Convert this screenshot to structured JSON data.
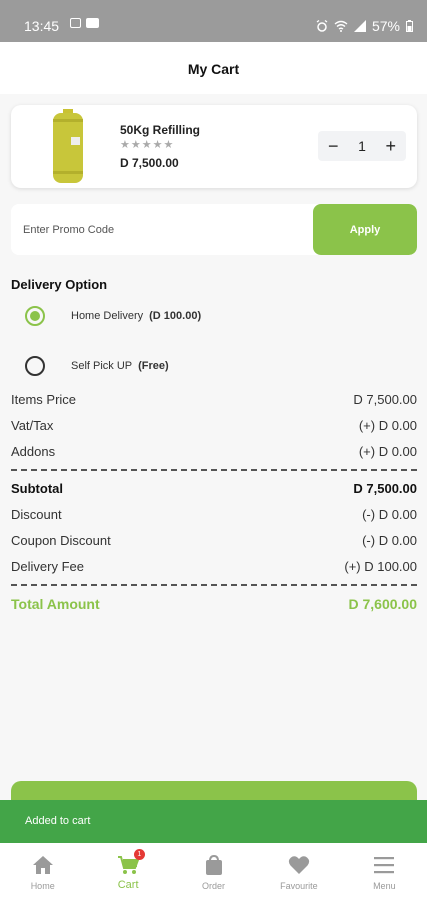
{
  "status_bar": {
    "time": "13:45",
    "battery": "57%"
  },
  "header": {
    "title": "My Cart"
  },
  "cart_item": {
    "name": "50Kg Refilling",
    "stars": "★★★★★",
    "price": "D 7,500.00",
    "quantity": "1",
    "minus_icon": "−",
    "plus_icon": "+"
  },
  "promo": {
    "placeholder": "Enter Promo Code",
    "apply_label": "Apply"
  },
  "delivery": {
    "title": "Delivery Option",
    "options": [
      {
        "label": "Home Delivery",
        "fee": "(D 100.00)",
        "selected": true
      },
      {
        "label": "Self Pick UP",
        "fee": "(Free)",
        "selected": false
      }
    ]
  },
  "summary": {
    "items_price": {
      "label": "Items Price",
      "value": "D 7,500.00"
    },
    "vat": {
      "label": "Vat/Tax",
      "value": "(+) D 0.00"
    },
    "addons": {
      "label": "Addons",
      "value": "(+) D 0.00"
    },
    "subtotal": {
      "label": "Subtotal",
      "value": "D 7,500.00"
    },
    "discount": {
      "label": "Discount",
      "value": "(-) D 0.00"
    },
    "coupon": {
      "label": "Coupon Discount",
      "value": "(-) D 0.00"
    },
    "delivery_fee": {
      "label": "Delivery Fee",
      "value": "(+) D 100.00"
    },
    "total": {
      "label": "Total Amount",
      "value": "D 7,600.00"
    }
  },
  "snackbar": {
    "message": "Added to cart"
  },
  "bottom_nav": {
    "items": [
      {
        "label": "Home",
        "icon": "home-icon"
      },
      {
        "label": "Cart",
        "icon": "cart-icon",
        "badge": "1",
        "active": true
      },
      {
        "label": "Order",
        "icon": "bag-icon"
      },
      {
        "label": "Favourite",
        "icon": "heart-icon"
      },
      {
        "label": "Menu",
        "icon": "menu-icon"
      }
    ]
  },
  "colors": {
    "accent": "#8bc34a",
    "snackbar": "#43a548",
    "badge": "#e53935"
  }
}
